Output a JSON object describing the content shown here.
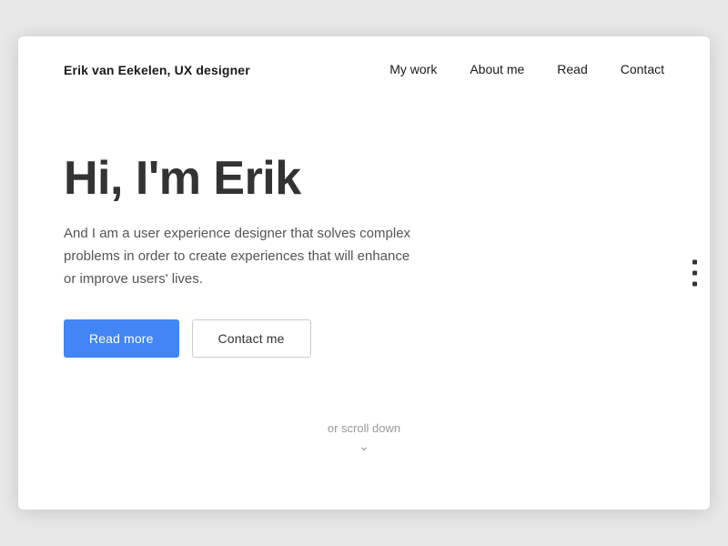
{
  "nav": {
    "logo": "Erik van Eekelen, UX designer",
    "links": [
      {
        "label": "My work",
        "href": "#"
      },
      {
        "label": "About me",
        "href": "#"
      },
      {
        "label": "Read",
        "href": "#"
      },
      {
        "label": "Contact",
        "href": "#"
      }
    ]
  },
  "hero": {
    "heading": "Hi, I'm Erik",
    "subtext": "And I am a user experience designer that solves complex problems in order to create experiences that will enhance or improve users' lives.",
    "btn_primary": "Read more",
    "btn_secondary": "Contact me"
  },
  "scroll": {
    "label": "or scroll down",
    "chevron": "⌄"
  },
  "colors": {
    "accent": "#4285f4"
  }
}
